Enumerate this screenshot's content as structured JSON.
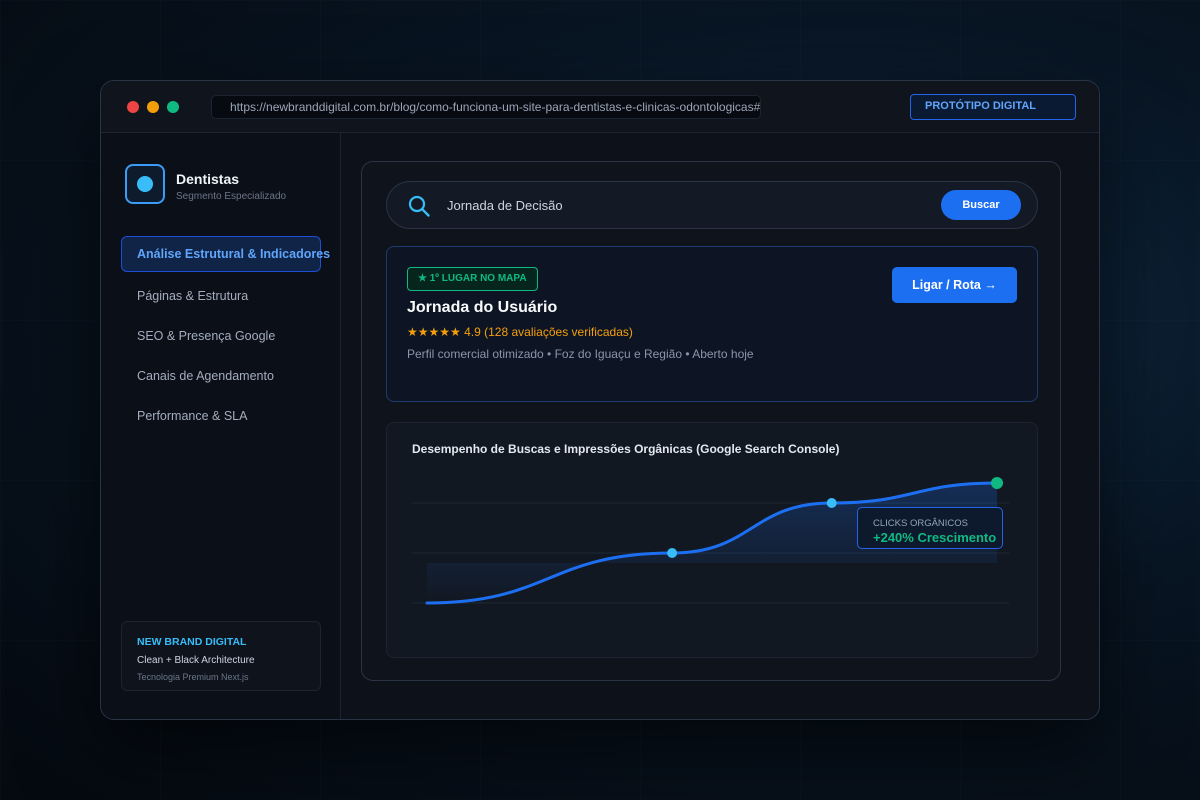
{
  "browser": {
    "url": "https://newbranddigital.com.br/blog/como-funciona-um-site-para-dentistas-e-clinicas-odontologicas#analise",
    "prototype_label": "PROTÓTIPO DIGITAL"
  },
  "sidebar": {
    "brand_title": "Dentistas",
    "brand_subtitle": "Segmento Especializado",
    "items": [
      {
        "label": "Análise Estrutural & Indicadores",
        "active": true
      },
      {
        "label": "Páginas & Estrutura",
        "active": false
      },
      {
        "label": "SEO & Presença Google",
        "active": false
      },
      {
        "label": "Canais de Agendamento",
        "active": false
      },
      {
        "label": "Performance & SLA",
        "active": false
      }
    ],
    "footer": {
      "title": "NEW BRAND DIGITAL",
      "line1": "Clean + Black Architecture",
      "line2": "Tecnologia Premium Next.js"
    }
  },
  "search": {
    "value": "Jornada de Decisão",
    "button_label": "Buscar"
  },
  "card": {
    "badge": "★ 1º LUGAR NO MAPA",
    "title": "Jornada do Usuário",
    "rating": "★★★★★ 4.9 (128 avaliações verificadas)",
    "description": "Perfil comercial otimizado • Foz do Iguaçu e Região • Aberto hoje",
    "cta_label": "Ligar / Rota →"
  },
  "chart": {
    "title": "Desempenho de Buscas e Impressões Orgânicas (Google Search Console)",
    "tooltip_label": "CLICKS ORGÂNICOS",
    "tooltip_value": "+240% Crescimento"
  },
  "chart_data": {
    "type": "line",
    "title": "Desempenho de Buscas e Impressões Orgânicas (Google Search Console)",
    "xlabel": "",
    "ylabel": "",
    "grid": true,
    "points": [
      {
        "x": 0,
        "y": 0.1
      },
      {
        "x": 0.43,
        "y": 0.6
      },
      {
        "x": 0.71,
        "y": 1.1
      },
      {
        "x": 1.0,
        "y": 1.3
      }
    ],
    "marked_points": [
      1,
      2,
      3
    ],
    "ylim": [
      0,
      1.5
    ],
    "xlim": [
      0,
      1
    ],
    "annotation": "+240% Crescimento"
  },
  "colors": {
    "accent": "#1d6ff2",
    "line": "#1d6ff2",
    "marker": "#38bdf8",
    "highlight": "#10b981"
  }
}
